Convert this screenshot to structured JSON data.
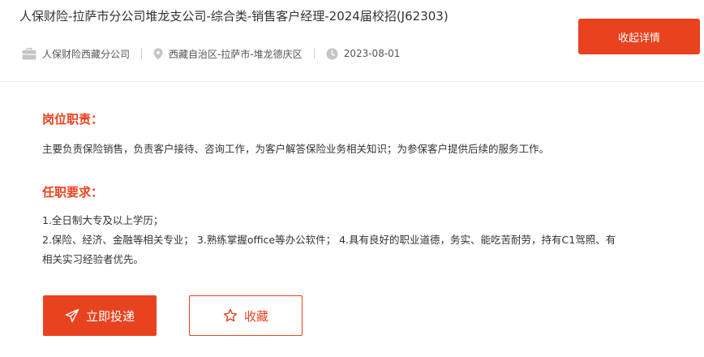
{
  "job": {
    "title": "人保财险-拉萨市分公司堆龙支公司-综合类-销售客户经理-2024届校招(J62303)",
    "company": "人保财险西藏分公司",
    "location": "西藏自治区-拉萨市-堆龙德庆区",
    "date": "2023-08-01"
  },
  "actions": {
    "collapse_label": "收起详情",
    "apply_label": "立即投递",
    "favorite_label": "收藏"
  },
  "duties": {
    "heading": "岗位职责：",
    "text": "主要负责保险销售，负责客户接待、咨询工作，为客户解答保险业务相关知识；为参保客户提供后续的服务工作。"
  },
  "requirements": {
    "heading": "任职要求：",
    "lines": [
      "1.全日制大专及以上学历；",
      "2.保险、经济、金融等相关专业； 3.熟练掌握office等办公软件； 4.具有良好的职业道德，务实、能吃苦耐劳，持有C1驾照、有",
      "相关实习经验者优先。"
    ]
  },
  "theme": {
    "accent": "#e8421f",
    "icon_gray": "#c4c4c4"
  },
  "icons": [
    "briefcase-icon",
    "location-pin-icon",
    "clock-icon",
    "send-icon",
    "star-icon"
  ]
}
